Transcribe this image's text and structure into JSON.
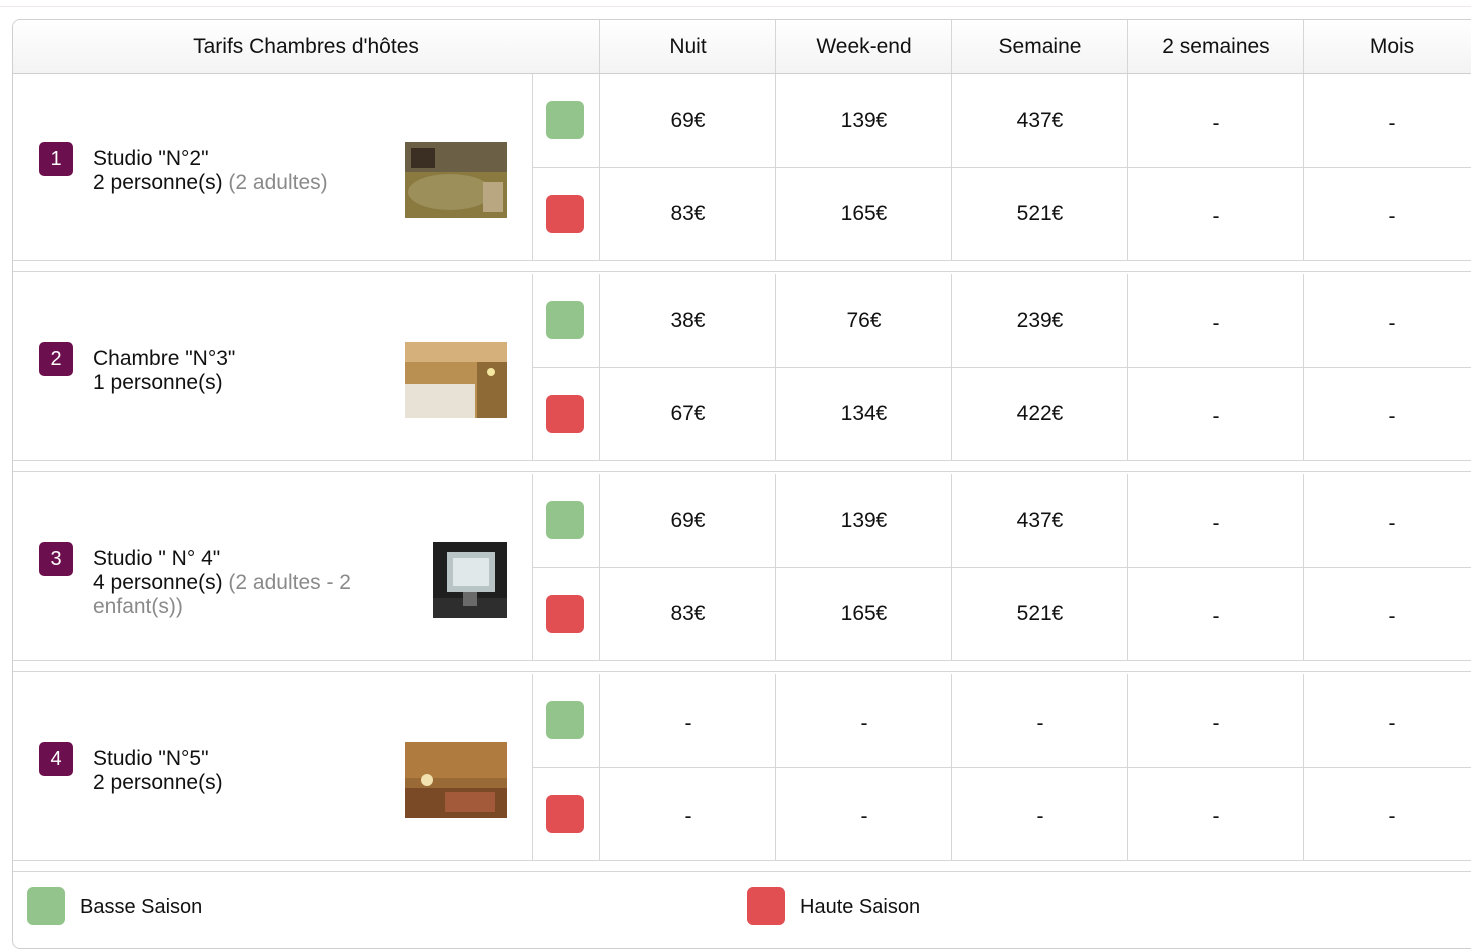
{
  "header": {
    "title": "Tarifs Chambres d'hôtes",
    "columns": [
      "Nuit",
      "Week-end",
      "Semaine",
      "2 semaines",
      "Mois"
    ]
  },
  "rooms": [
    {
      "number": "1",
      "name": "Studio \"N°2\"",
      "capacity": "2 personne(s)",
      "detail": "(2 adultes)",
      "prices": {
        "basse": [
          "69€",
          "139€",
          "437€",
          "-",
          "-"
        ],
        "haute": [
          "83€",
          "165€",
          "521€",
          "-",
          "-"
        ]
      }
    },
    {
      "number": "2",
      "name": "Chambre \"N°3\"",
      "capacity": "1 personne(s)",
      "detail": "",
      "prices": {
        "basse": [
          "38€",
          "76€",
          "239€",
          "-",
          "-"
        ],
        "haute": [
          "67€",
          "134€",
          "422€",
          "-",
          "-"
        ]
      }
    },
    {
      "number": "3",
      "name": "Studio \" N° 4\"",
      "capacity": "4 personne(s)",
      "detail": "(2 adultes - 2 enfant(s))",
      "prices": {
        "basse": [
          "69€",
          "139€",
          "437€",
          "-",
          "-"
        ],
        "haute": [
          "83€",
          "165€",
          "521€",
          "-",
          "-"
        ]
      }
    },
    {
      "number": "4",
      "name": "Studio \"N°5\"",
      "capacity": "2 personne(s)",
      "detail": "",
      "prices": {
        "basse": [
          "-",
          "-",
          "-",
          "-",
          "-"
        ],
        "haute": [
          "-",
          "-",
          "-",
          "-",
          "-"
        ]
      }
    }
  ],
  "legend": {
    "basse_label": "Basse Saison",
    "haute_label": "Haute Saison"
  },
  "colors": {
    "basse": "#93c48b",
    "haute": "#e24f52",
    "badge": "#6b0f4e"
  }
}
